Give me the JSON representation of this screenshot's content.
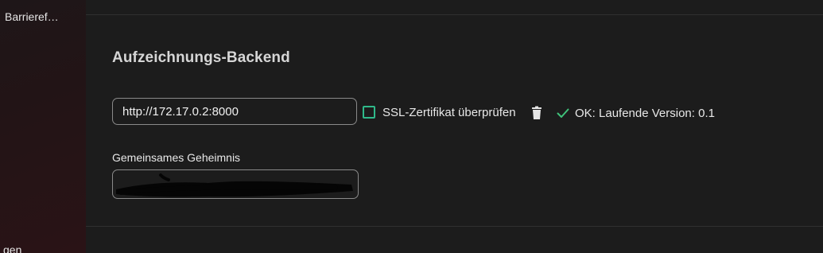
{
  "sidebar": {
    "items": [
      {
        "label": "Barrieref…"
      },
      {
        "label": "gen"
      }
    ]
  },
  "main": {
    "section_title": "Aufzeichnungs-Backend",
    "url_field": {
      "value": "http://172.17.0.2:8000"
    },
    "ssl_checkbox": {
      "label": "SSL-Zertifikat überprüfen",
      "checked": false
    },
    "delete_icon": "trash-icon",
    "status": {
      "icon": "check-icon",
      "icon_color": "#3fc27a",
      "text": "OK: Laufende Version: 0.1"
    },
    "secret_field": {
      "label": "Gemeinsames Geheimnis",
      "value": ""
    }
  },
  "colors": {
    "accent": "#2fb98a",
    "background": "#1c1c1c"
  }
}
